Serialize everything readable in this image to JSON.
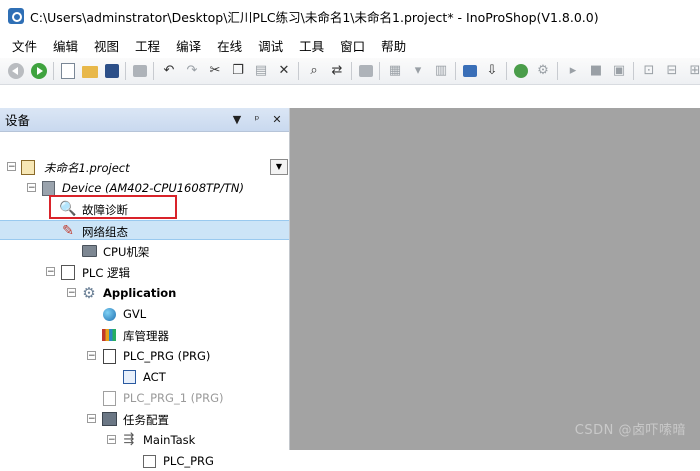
{
  "window": {
    "title": "C:\\Users\\adminstrator\\Desktop\\汇川PLC练习\\未命名1\\未命名1.project* - InoProShop(V1.8.0.0)"
  },
  "menu": [
    "文件",
    "编辑",
    "视图",
    "工程",
    "编译",
    "在线",
    "调试",
    "工具",
    "窗口",
    "帮助"
  ],
  "toolbar": {
    "icons": [
      "back-icon",
      "forward-icon",
      "new-icon",
      "open-icon",
      "save-icon",
      "print-icon",
      "undo-icon",
      "redo-icon",
      "cut-icon",
      "copy-icon",
      "paste-icon",
      "delete-icon",
      "find-icon",
      "replace-icon",
      "window-icon",
      "build-icon",
      "dropdown-icon",
      "device-icon",
      "download-icon",
      "login-icon",
      "logout-icon",
      "run-icon",
      "stop-icon",
      "reset-icon",
      "step-icon",
      "breakpoint-icon"
    ]
  },
  "devices_pane": {
    "title": "设备",
    "controls": [
      "▼",
      "ᵖ",
      "✕"
    ],
    "selected_label": "网络组态",
    "tree": [
      {
        "label": "未命名1.project",
        "icon": "project-icon",
        "style": "italic"
      },
      {
        "label": "Device (AM402-CPU1608TP/TN)",
        "icon": "device-icon",
        "style": "italic"
      },
      {
        "label": "故障诊断",
        "icon": "diagnosis-icon",
        "style": "normal"
      },
      {
        "label": "网络组态",
        "icon": "network-config-icon",
        "style": "normal"
      },
      {
        "label": "CPU机架",
        "icon": "cpu-rack-icon",
        "style": "normal"
      },
      {
        "label": "PLC 逻辑",
        "icon": "plc-logic-icon",
        "style": "normal"
      },
      {
        "label": "Application",
        "icon": "application-icon",
        "style": "bold"
      },
      {
        "label": "GVL",
        "icon": "gvl-icon",
        "style": "normal"
      },
      {
        "label": "库管理器",
        "icon": "library-manager-icon",
        "style": "normal"
      },
      {
        "label": "PLC_PRG (PRG)",
        "icon": "program-icon",
        "style": "normal"
      },
      {
        "label": "ACT",
        "icon": "action-icon",
        "style": "normal"
      },
      {
        "label": "PLC_PRG_1 (PRG)",
        "icon": "program-icon",
        "style": "disabled"
      },
      {
        "label": "任务配置",
        "icon": "task-config-icon",
        "style": "normal"
      },
      {
        "label": "MainTask",
        "icon": "maintask-icon",
        "style": "normal"
      },
      {
        "label": "PLC_PRG",
        "icon": "program-call-icon",
        "style": "normal"
      }
    ],
    "project_selector_arrow": "▼"
  },
  "watermark": "CSDN @卤吓嗦暗"
}
